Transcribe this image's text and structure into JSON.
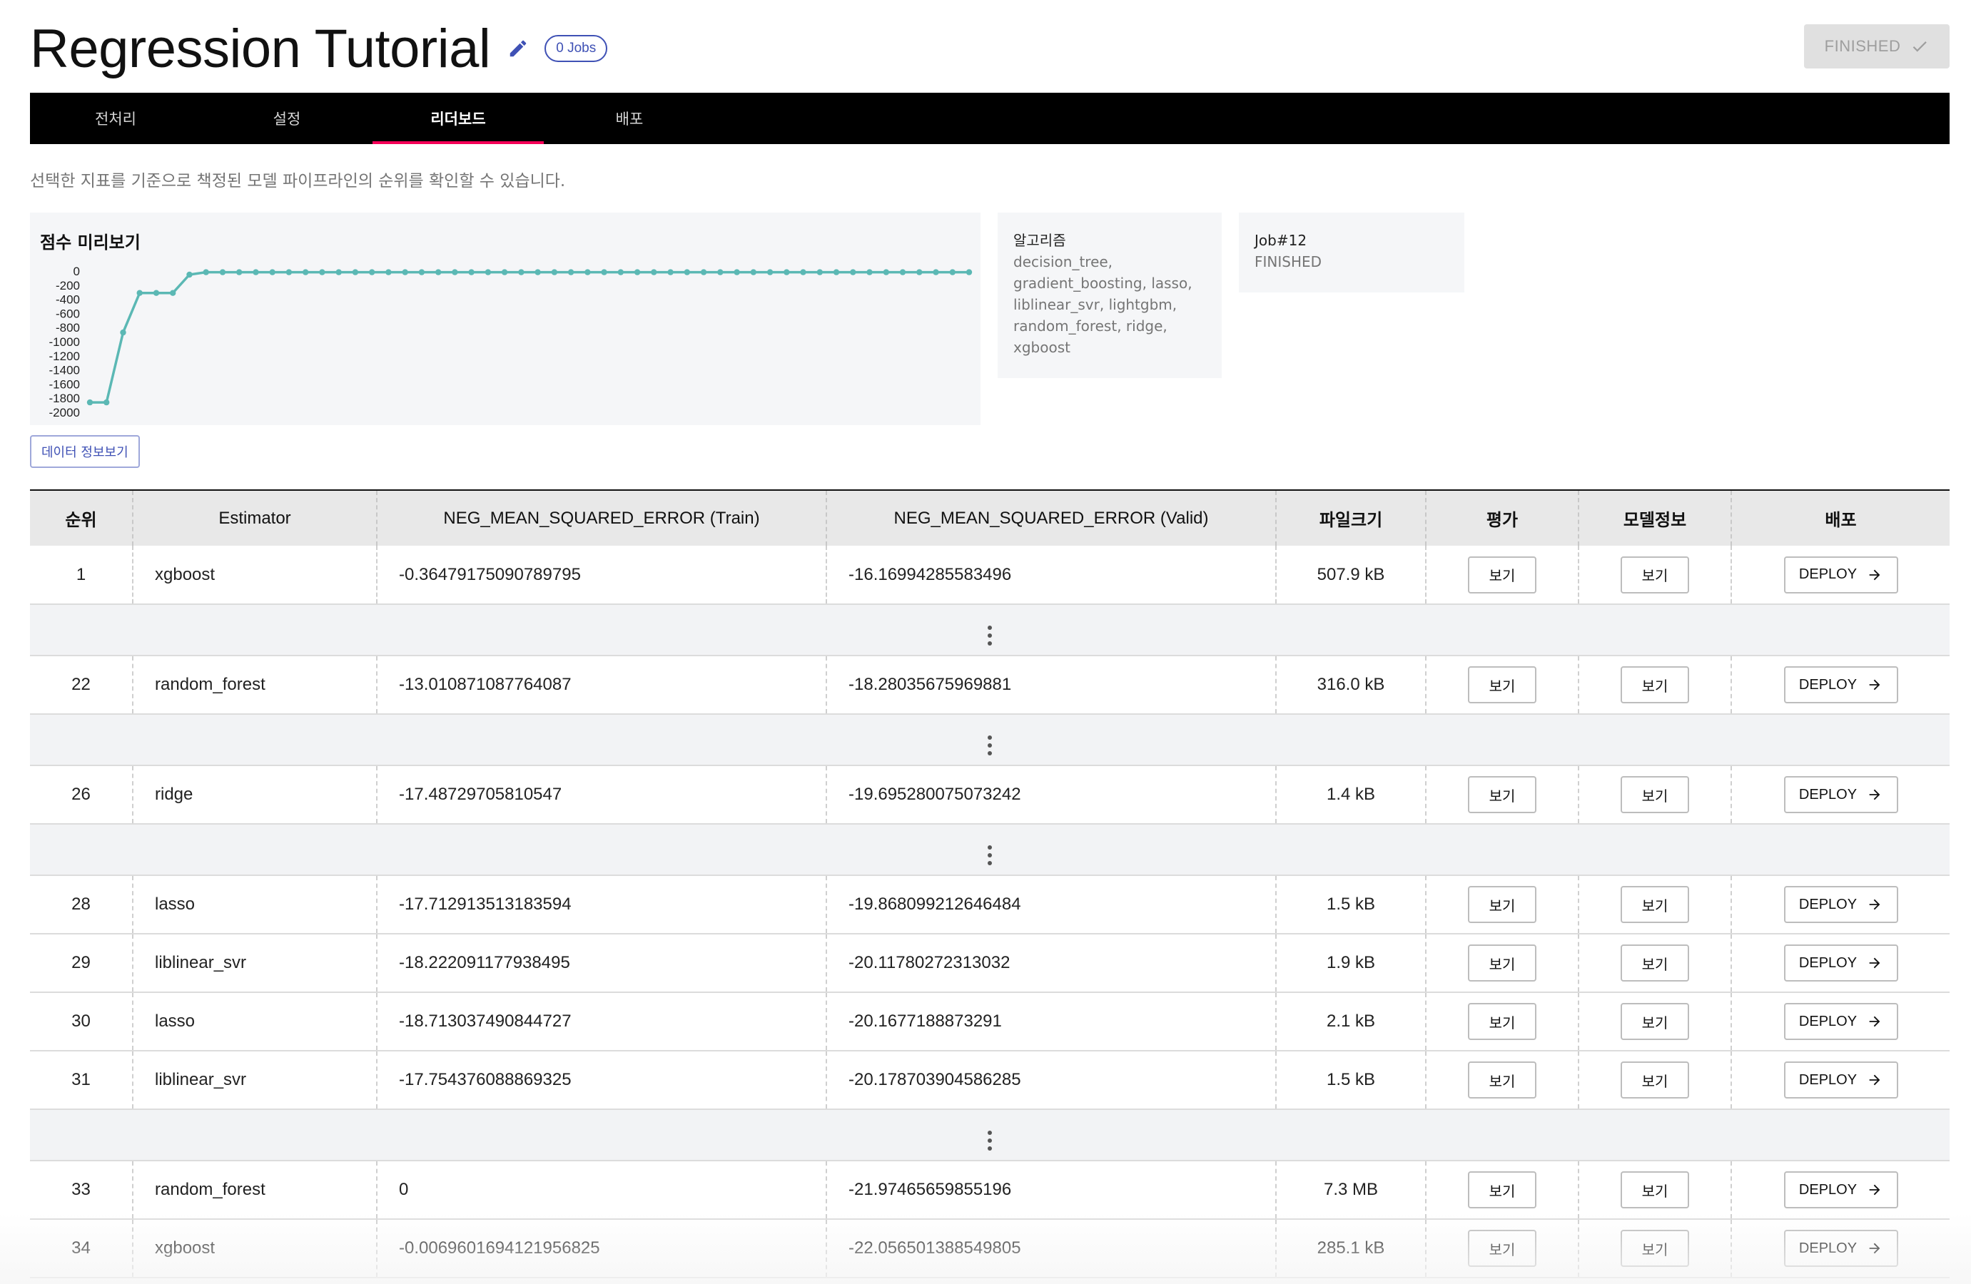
{
  "header": {
    "title": "Regression Tutorial",
    "jobs_badge": "0 Jobs",
    "status_button": "FINISHED"
  },
  "tabs": [
    {
      "label": "전처리",
      "active": false
    },
    {
      "label": "설정",
      "active": false
    },
    {
      "label": "리더보드",
      "active": true
    },
    {
      "label": "배포",
      "active": false
    }
  ],
  "description": "선택한 지표를 기준으로 책정된 모델 파이프라인의 순위를 확인할 수 있습니다.",
  "score_preview": {
    "title": "점수 미리보기",
    "y_ticks": [
      "0",
      "-200",
      "-400",
      "-600",
      "-800",
      "-1000",
      "-1200",
      "-1400",
      "-1600",
      "-1800",
      "-2000"
    ]
  },
  "chart_data": {
    "type": "line",
    "title": "점수 미리보기",
    "xlabel": "",
    "ylabel": "",
    "ylim": [
      -2000,
      0
    ],
    "y_ticks": [
      0,
      -200,
      -400,
      -600,
      -800,
      -1000,
      -1200,
      -1400,
      -1600,
      -1800,
      -2000
    ],
    "grid": false,
    "color": "#5bb8b4",
    "values": [
      -1860,
      -1860,
      -870,
      -310,
      -310,
      -310,
      -50,
      -16,
      -16,
      -16,
      -16,
      -16,
      -16,
      -16,
      -16,
      -16,
      -16,
      -16,
      -16,
      -16,
      -16,
      -16,
      -16,
      -16,
      -16,
      -16,
      -16,
      -16,
      -16,
      -16,
      -16,
      -16,
      -16,
      -16,
      -16,
      -16,
      -16,
      -16,
      -16,
      -16,
      -16,
      -16,
      -16,
      -16,
      -16,
      -16,
      -16,
      -16,
      -16,
      -16,
      -16,
      -16,
      -16,
      -16
    ]
  },
  "algorithm_card": {
    "label": "알고리즘",
    "value_lines": [
      "decision_tree,",
      "gradient_boosting, lasso,",
      "liblinear_svr, lightgbm,",
      "random_forest, ridge,",
      "xgboost"
    ]
  },
  "job_card": {
    "label": "Job#12",
    "status": "FINISHED"
  },
  "data_info_button": "데이터 정보보기",
  "table": {
    "columns": [
      "순위",
      "Estimator",
      "NEG_MEAN_SQUARED_ERROR (Train)",
      "NEG_MEAN_SQUARED_ERROR (Valid)",
      "파일크기",
      "평가",
      "모델정보",
      "배포"
    ],
    "view_label": "보기",
    "deploy_label": "DEPLOY",
    "rows": [
      {
        "kind": "row",
        "rank": "1",
        "estimator": "xgboost",
        "train": "-0.36479175090789795",
        "valid": "-16.16994285583496",
        "size": "507.9 kB"
      },
      {
        "kind": "gap"
      },
      {
        "kind": "row",
        "rank": "22",
        "estimator": "random_forest",
        "train": "-13.010871087764087",
        "valid": "-18.28035675969881",
        "size": "316.0 kB"
      },
      {
        "kind": "gap"
      },
      {
        "kind": "row",
        "rank": "26",
        "estimator": "ridge",
        "train": "-17.48729705810547",
        "valid": "-19.695280075073242",
        "size": "1.4 kB"
      },
      {
        "kind": "gap"
      },
      {
        "kind": "row",
        "rank": "28",
        "estimator": "lasso",
        "train": "-17.712913513183594",
        "valid": "-19.868099212646484",
        "size": "1.5 kB"
      },
      {
        "kind": "row",
        "rank": "29",
        "estimator": "liblinear_svr",
        "train": "-18.222091177938495",
        "valid": "-20.11780272313032",
        "size": "1.9 kB"
      },
      {
        "kind": "row",
        "rank": "30",
        "estimator": "lasso",
        "train": "-18.713037490844727",
        "valid": "-20.1677188873291",
        "size": "2.1 kB"
      },
      {
        "kind": "row",
        "rank": "31",
        "estimator": "liblinear_svr",
        "train": "-17.754376088869325",
        "valid": "-20.178703904586285",
        "size": "1.5 kB"
      },
      {
        "kind": "gap"
      },
      {
        "kind": "row",
        "rank": "33",
        "estimator": "random_forest",
        "train": "0",
        "valid": "-21.97465659855196",
        "size": "7.3 MB"
      },
      {
        "kind": "row",
        "rank": "34",
        "estimator": "xgboost",
        "train": "-0.0069601694121956825",
        "valid": "-22.056501388549805",
        "size": "285.1 kB"
      }
    ]
  }
}
